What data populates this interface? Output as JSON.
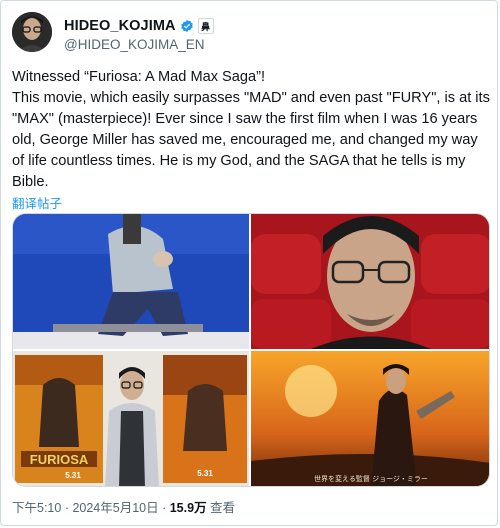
{
  "author": {
    "display_name": "HIDEO_KOJIMA",
    "handle": "@HIDEO_KOJIMA_EN",
    "affiliate_glyph": "鼻"
  },
  "tweet": {
    "text": "Witnessed “Furiosa: A Mad Max Saga”!\nThis movie, which easily surpasses \"MAD\" and even past \"FURY\", is at its \"MAX\" (masterpiece)! Ever since I saw the first film when I was 16 years old, George Miller has saved me, encouraged me, and changed my way of life countless times. He is my God, and the SAGA that he tells is my Bible.",
    "translate_label": "翻译帖子"
  },
  "media": {
    "photo4_caption": "世界を変える監督 ジョージ・ミラー",
    "poster_title": "FURIOSA",
    "poster_date_left": "5.31",
    "poster_date_right": "5.31"
  },
  "meta": {
    "time": "下午5:10",
    "sep1": " · ",
    "date": "2024年5月10日",
    "sep2": " · ",
    "views": "15.9万",
    "views_label": " 查看"
  },
  "colors": {
    "accent": "#1d9bf0",
    "secondary_text": "#536471",
    "border": "#cfd9de"
  }
}
